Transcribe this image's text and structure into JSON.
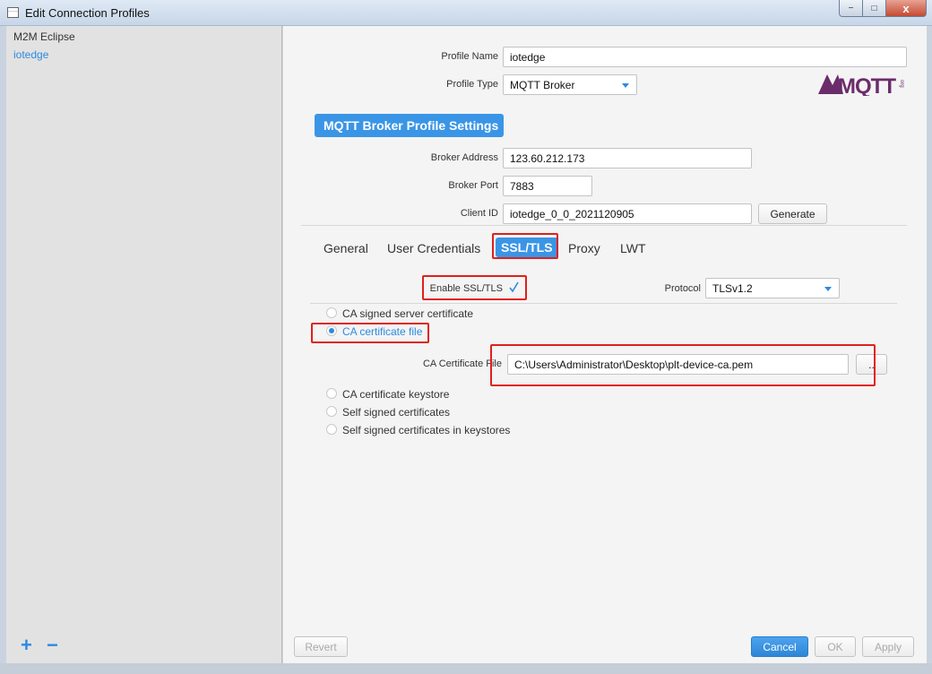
{
  "window": {
    "title": "Edit Connection Profiles",
    "controls": {
      "minimize": "−",
      "maximize": "□",
      "close": "x"
    }
  },
  "sidebar": {
    "items": [
      {
        "label": "M2M Eclipse"
      },
      {
        "label": "iotedge"
      }
    ],
    "add_label": "+",
    "remove_label": "−"
  },
  "profile": {
    "name_label": "Profile Name",
    "name_value": "iotedge",
    "type_label": "Profile Type",
    "type_value": "MQTT Broker",
    "logo_text": "MQTT"
  },
  "broker": {
    "header": "MQTT Broker Profile Settings",
    "address_label": "Broker Address",
    "address_value": "123.60.212.173",
    "port_label": "Broker Port",
    "port_value": "7883",
    "client_id_label": "Client ID",
    "client_id_value": "iotedge_0_0_2021120905",
    "generate_label": "Generate"
  },
  "tabs": [
    {
      "label": "General"
    },
    {
      "label": "User Credentials"
    },
    {
      "label": "SSL/TLS",
      "active": true
    },
    {
      "label": "Proxy"
    },
    {
      "label": "LWT"
    }
  ],
  "ssl": {
    "enable_label": "Enable SSL/TLS",
    "enable_checked": true,
    "protocol_label": "Protocol",
    "protocol_value": "TLSv1.2",
    "options": [
      {
        "label": "CA signed server certificate",
        "selected": false
      },
      {
        "label": "CA certificate file",
        "selected": true
      },
      {
        "label": "CA certificate keystore",
        "selected": false
      },
      {
        "label": "Self signed certificates",
        "selected": false
      },
      {
        "label": "Self signed certificates in keystores",
        "selected": false
      }
    ],
    "ca_file_label": "CA Certificate File",
    "ca_file_value": "C:\\Users\\Administrator\\Desktop\\plt-device-ca.pem",
    "browse_label": ".."
  },
  "footer": {
    "revert_label": "Revert",
    "cancel_label": "Cancel",
    "ok_label": "OK",
    "apply_label": "Apply"
  },
  "colors": {
    "accent": "#3a95e6",
    "highlight": "#e0201b",
    "sidebar_bg": "#e2e2e2",
    "panel_bg": "#f4f4f4"
  }
}
